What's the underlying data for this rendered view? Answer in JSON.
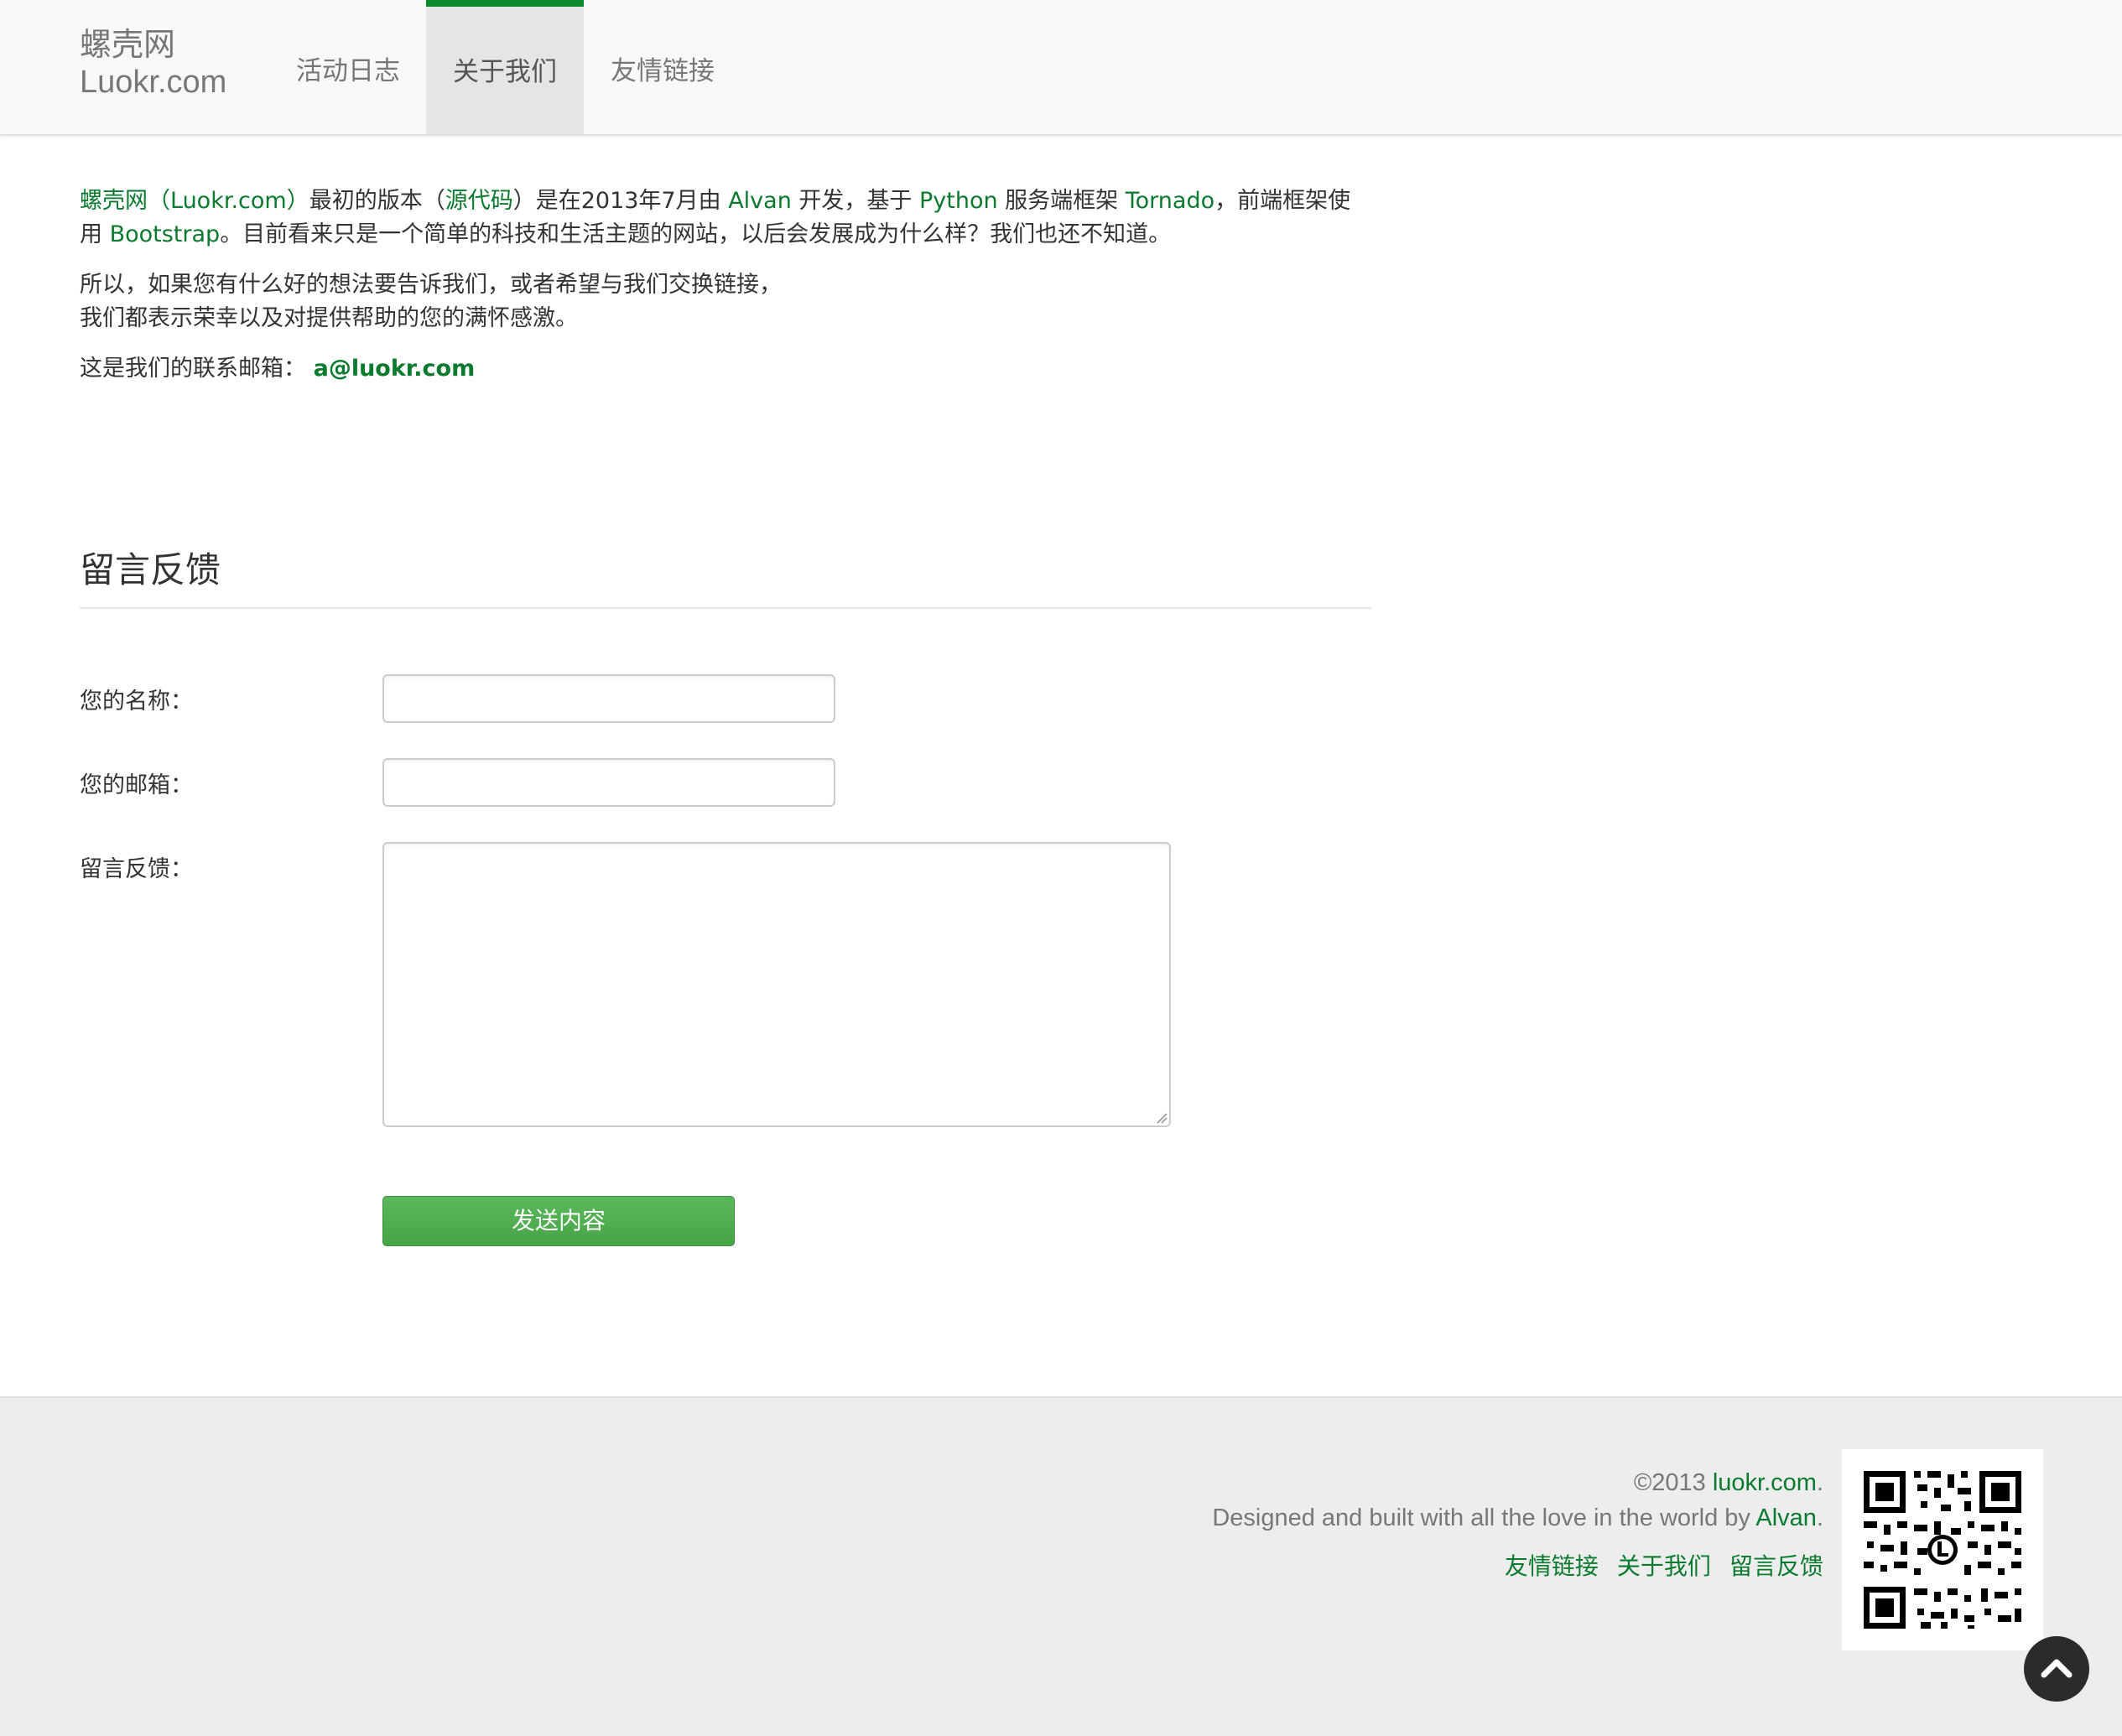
{
  "brand": {
    "line1": "螺壳网",
    "line2": "Luokr.com"
  },
  "nav": {
    "items": [
      {
        "label": "活动日志"
      },
      {
        "label": "关于我们",
        "active": true
      },
      {
        "label": "友情链接"
      }
    ]
  },
  "about": {
    "p1": {
      "site": "螺壳网（Luokr.com）",
      "t1": "最初的版本（",
      "source": "源代码",
      "t2": "）是在2013年7月由 ",
      "author": "Alvan",
      "t3": " 开发，基于 ",
      "python": "Python",
      "t4": " 服务端框架 ",
      "tornado": "Tornado",
      "t5": "，前端框架使用 ",
      "bootstrap": "Bootstrap",
      "t6": "。目前看来只是一个简单的科技和生活主题的网站，以后会发展成为什么样？我们也还不知道。"
    },
    "p2_line1": "所以，如果您有什么好的想法要告诉我们，或者希望与我们交换链接，",
    "p2_line2": "我们都表示荣幸以及对提供帮助的您的满怀感激。",
    "p3_label": "这是我们的联系邮箱：",
    "email": "a@luokr.com"
  },
  "feedback": {
    "title": "留言反馈",
    "name_label": "您的名称：",
    "name_value": "",
    "email_label": "您的邮箱：",
    "email_value": "",
    "message_label": "留言反馈：",
    "message_value": "",
    "submit_label": "发送内容"
  },
  "footer": {
    "copyright_prefix": "©2013 ",
    "copyright_link": "luokr.com",
    "copyright_suffix": ".",
    "designed_prefix": "Designed and built with all the love in the world by ",
    "designed_link": "Alvan",
    "designed_suffix": ".",
    "links": [
      "友情链接",
      "关于我们",
      "留言反馈"
    ]
  },
  "icons": {
    "qr": "qr-code-icon",
    "back_to_top": "chevron-up-icon"
  },
  "colors": {
    "accent": "#0a7a2e",
    "button": "#4cae4c",
    "nav_active_bar": "#0b8a2f"
  }
}
